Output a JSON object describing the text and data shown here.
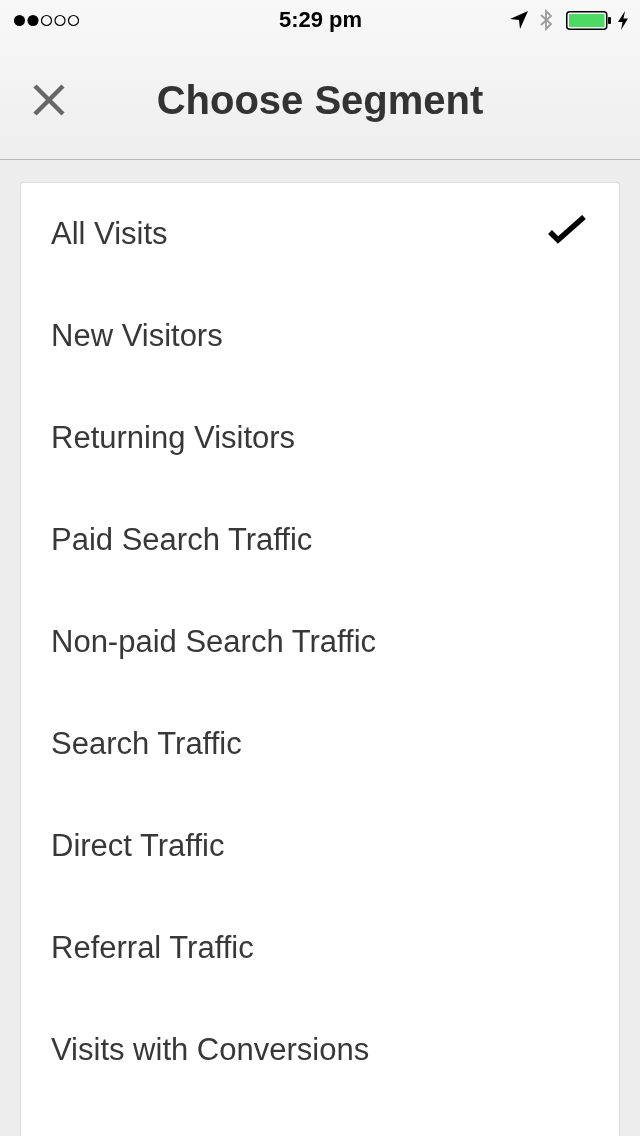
{
  "status_bar": {
    "time": "5:29 pm"
  },
  "header": {
    "title": "Choose Segment"
  },
  "segments": [
    {
      "label": "All Visits",
      "selected": true
    },
    {
      "label": "New Visitors",
      "selected": false
    },
    {
      "label": "Returning Visitors",
      "selected": false
    },
    {
      "label": "Paid Search Traffic",
      "selected": false
    },
    {
      "label": "Non-paid Search Traffic",
      "selected": false
    },
    {
      "label": "Search Traffic",
      "selected": false
    },
    {
      "label": "Direct Traffic",
      "selected": false
    },
    {
      "label": "Referral Traffic",
      "selected": false
    },
    {
      "label": "Visits with Conversions",
      "selected": false
    }
  ]
}
